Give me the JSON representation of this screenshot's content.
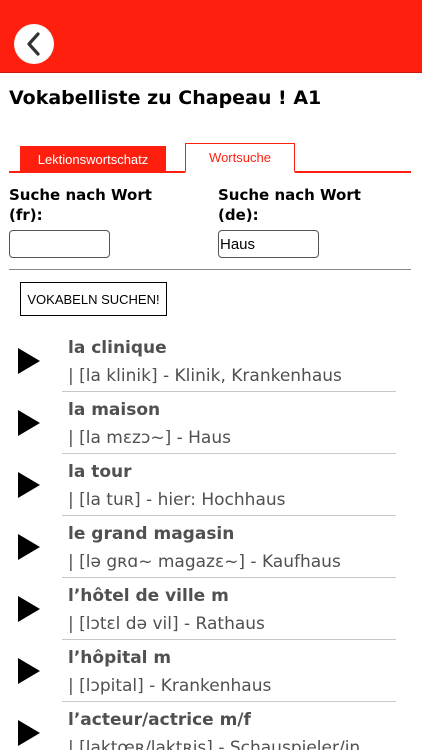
{
  "header": {
    "back_icon": "chevron-left-icon",
    "bar_color": "#ff1f0f"
  },
  "page": {
    "title": "Vokabelliste zu Chapeau ! A1"
  },
  "tabs": [
    {
      "label": "Lektionswortschatz",
      "active": false
    },
    {
      "label": "Wortsuche",
      "active": true
    }
  ],
  "search": {
    "fr": {
      "label": "Suche nach Wort (fr):",
      "value": ""
    },
    "de": {
      "label": "Suche nach Wort (de):",
      "value": "Haus"
    },
    "button_label": "VOKABELN SUCHEN!"
  },
  "results": [
    {
      "word": "la clinique",
      "detail": "| [la klinik] - Klinik, Krankenhaus"
    },
    {
      "word": "la maison",
      "detail": "| [la mɛzɔ~] - Haus"
    },
    {
      "word": "la tour",
      "detail": "| [la tuʀ] - hier: Hochhaus"
    },
    {
      "word": "le grand magasin",
      "detail": "| [lə gʀɑ~ magazɛ~] - Kaufhaus"
    },
    {
      "word": "l’hôtel de ville m",
      "detail": "| [lɔtɛl də vil] - Rathaus"
    },
    {
      "word": "l’hôpital m",
      "detail": "| [lɔpital] - Krankenhaus"
    },
    {
      "word": "l’acteur/actrice m/f",
      "detail": "| [laktœʀ/laktʀis] - Schauspieler/in"
    }
  ]
}
